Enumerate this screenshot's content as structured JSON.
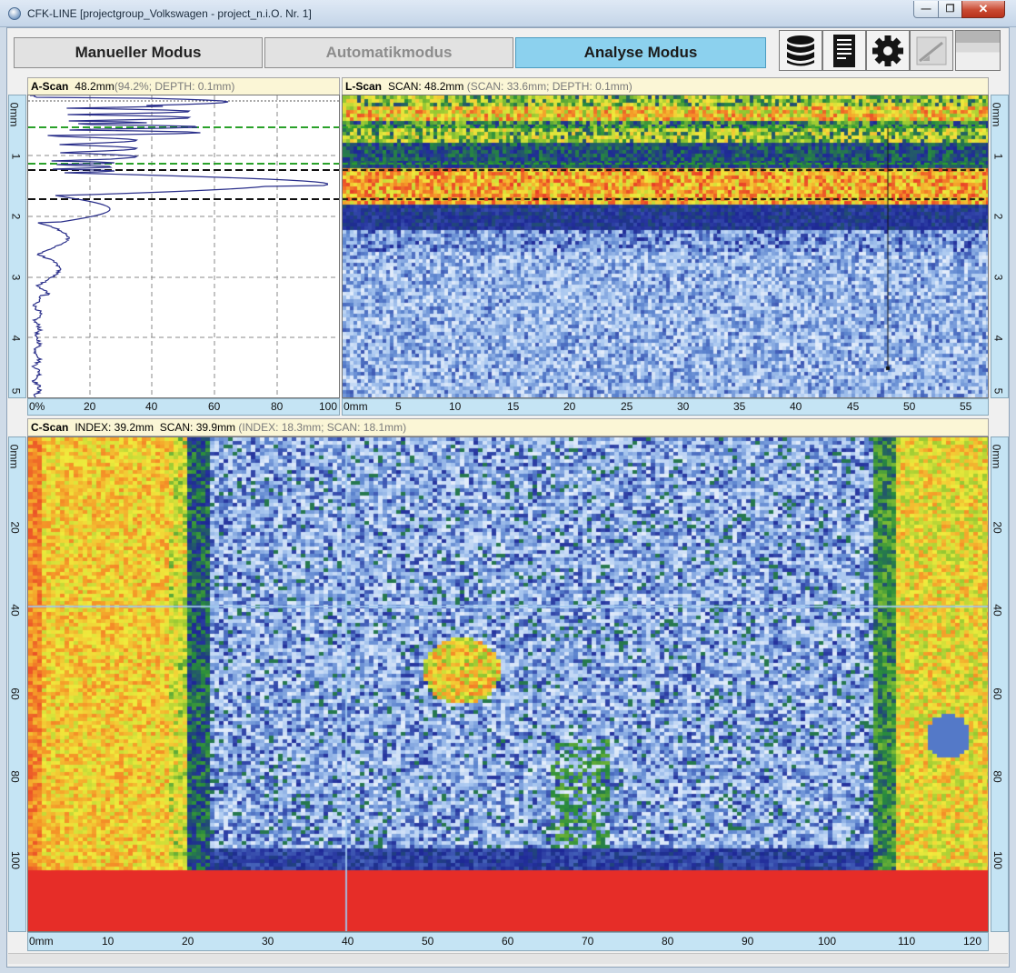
{
  "window": {
    "title": "CFK-LINE [projectgroup_Volkswagen - project_n.i.O. Nr. 1]",
    "minimize": "—",
    "maximize": "❐",
    "close": "✕"
  },
  "modes": {
    "manual": "Manueller Modus",
    "automatic": "Automatikmodus",
    "analysis": "Analyse Modus",
    "active": "analysis"
  },
  "toolbar": {
    "icons": [
      "database-icon",
      "report-icon",
      "gear-icon",
      "calibration-icon",
      "panel-icon"
    ]
  },
  "ascan": {
    "title": "A-Scan",
    "value": "48.2mm",
    "detail": "(94.2%; DEPTH: 0.1mm)",
    "x_ticks": [
      "0%",
      "20",
      "40",
      "60",
      "80",
      "100"
    ],
    "y_ticks": [
      "0mm",
      "1",
      "2",
      "3",
      "4",
      "5"
    ]
  },
  "lscan": {
    "title": "L-Scan",
    "value": "SCAN: 48.2mm",
    "detail": "(SCAN: 33.6mm; DEPTH: 0.1mm)",
    "x_ticks": [
      "0mm",
      "5",
      "10",
      "15",
      "20",
      "25",
      "30",
      "35",
      "40",
      "45",
      "50",
      "55"
    ],
    "y_ticks": [
      "0mm",
      "1",
      "2",
      "3",
      "4",
      "5"
    ]
  },
  "cscan": {
    "title": "C-Scan",
    "value": "INDEX: 39.2mm  SCAN: 39.9mm",
    "detail": "(INDEX: 18.3mm; SCAN: 18.1mm)",
    "x_ticks": [
      "0mm",
      "10",
      "20",
      "30",
      "40",
      "50",
      "60",
      "70",
      "80",
      "90",
      "100",
      "110",
      "120"
    ],
    "y_ticks": [
      "0mm",
      "20",
      "40",
      "60",
      "80",
      "100"
    ]
  },
  "colors": {
    "header_bg": "#fbf6d6",
    "axis_bg": "#c5e4f4",
    "active_mode": "#8cd1ee",
    "gate_green": "#2aa12a",
    "gate_black": "#111111",
    "backwall_red": "#e5302b"
  }
}
